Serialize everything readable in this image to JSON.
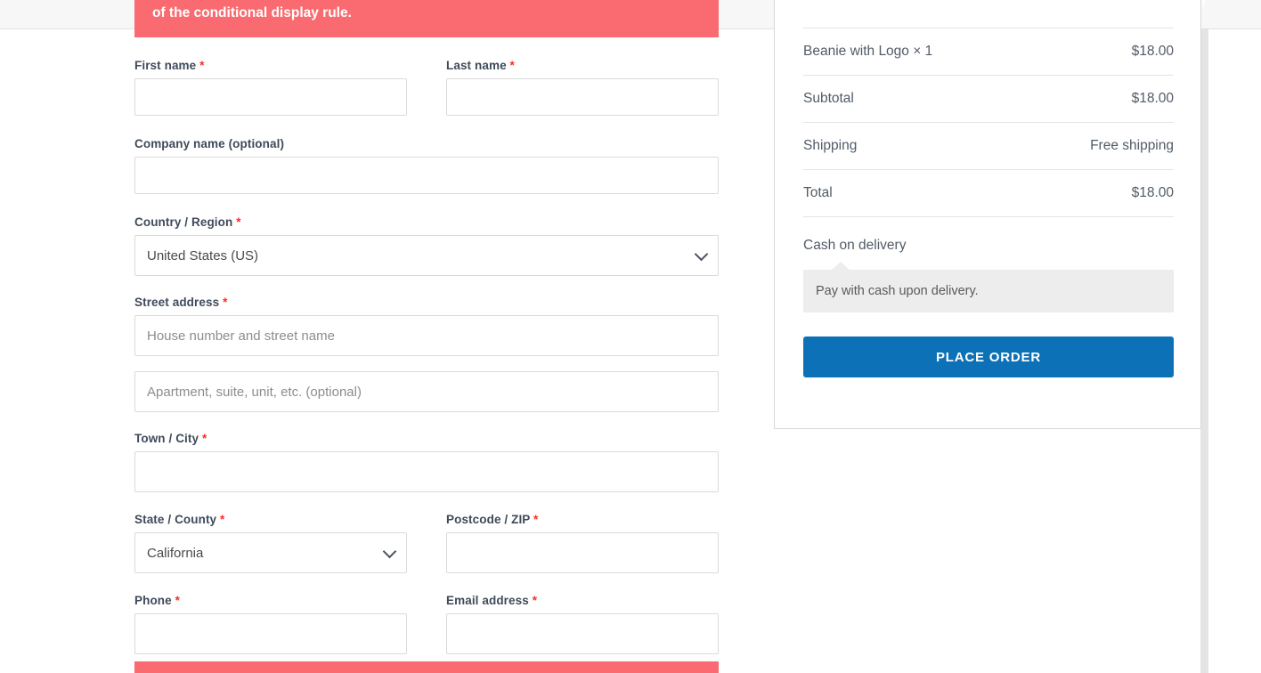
{
  "notice": {
    "message": "of the conditional display rule.",
    "color": "#f96b70"
  },
  "billing_form": {
    "fields": {
      "first_name": {
        "label": "First name",
        "required_mark": "*",
        "value": "",
        "placeholder": ""
      },
      "last_name": {
        "label": "Last name",
        "required_mark": "*",
        "value": "",
        "placeholder": ""
      },
      "company_name": {
        "label": "Company name (optional)",
        "required_mark": "",
        "value": "",
        "placeholder": ""
      },
      "country": {
        "label": "Country / Region",
        "required_mark": "*",
        "value": "United States (US)"
      },
      "street_address": {
        "label": "Street address",
        "required_mark": "*",
        "value": "",
        "placeholder": "House number and street name"
      },
      "address_2": {
        "label": "",
        "required_mark": "",
        "value": "",
        "placeholder": "Apartment, suite, unit, etc. (optional)"
      },
      "city": {
        "label": "Town / City",
        "required_mark": "*",
        "value": "",
        "placeholder": ""
      },
      "state": {
        "label": "State / County",
        "required_mark": "*",
        "value": "California"
      },
      "postcode": {
        "label": "Postcode / ZIP",
        "required_mark": "*",
        "value": "",
        "placeholder": ""
      },
      "phone": {
        "label": "Phone",
        "required_mark": "*",
        "value": "",
        "placeholder": ""
      },
      "email": {
        "label": "Email address",
        "required_mark": "*",
        "value": "",
        "placeholder": ""
      }
    }
  },
  "order_review": {
    "rows": [
      {
        "label": "Beanie with Logo × 1",
        "value": "$18.00"
      },
      {
        "label": "Subtotal",
        "value": "$18.00"
      },
      {
        "label": "Shipping",
        "value": "Free shipping"
      },
      {
        "label": "Total",
        "value": "$18.00"
      }
    ],
    "payment": {
      "method_title": "Cash on delivery",
      "description": "Pay with cash upon delivery."
    },
    "place_order_label": "PLACE ORDER",
    "accent_color": "#0c71b7"
  }
}
